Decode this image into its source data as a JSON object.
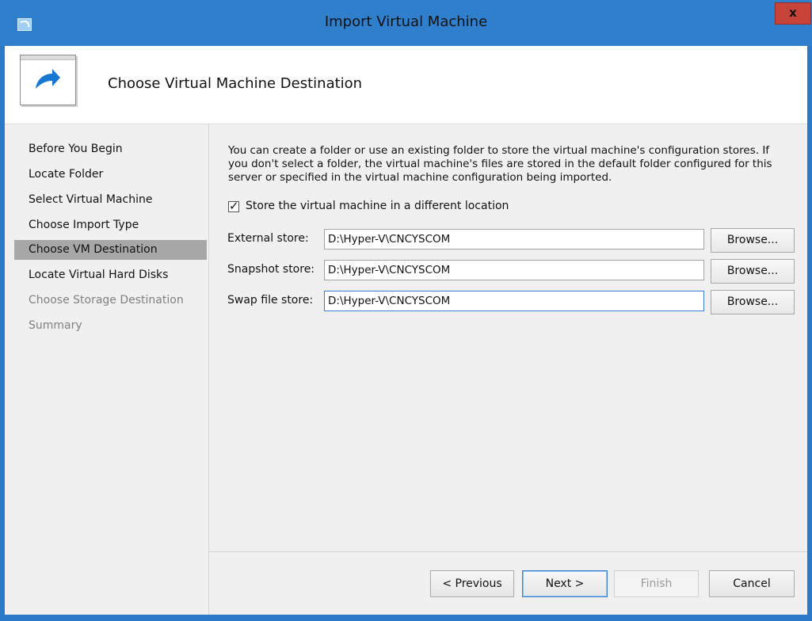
{
  "window": {
    "title": "Import Virtual Machine",
    "close_label": "x",
    "colors": {
      "frame": "#2f7fcd",
      "close": "#c94438",
      "selected_nav": "#a7a7a7"
    }
  },
  "header": {
    "title": "Choose Virtual Machine Destination",
    "icon": "arrow-right-icon"
  },
  "nav": {
    "items": [
      {
        "label": "Before You Begin",
        "state": "normal"
      },
      {
        "label": "Locate Folder",
        "state": "normal"
      },
      {
        "label": "Select Virtual Machine",
        "state": "normal"
      },
      {
        "label": "Choose Import Type",
        "state": "normal"
      },
      {
        "label": "Choose VM Destination",
        "state": "selected"
      },
      {
        "label": "Locate Virtual Hard Disks",
        "state": "normal"
      },
      {
        "label": "Choose Storage Destination",
        "state": "disabled"
      },
      {
        "label": "Summary",
        "state": "disabled"
      }
    ]
  },
  "content": {
    "description": "You can create a folder or use an existing folder to store the virtual machine's configuration stores. If you don't select a folder, the virtual machine's files are stored in the default folder configured for this server or specified in the virtual machine configuration being imported.",
    "different_location_label": "Store the virtual machine in a different location",
    "different_location_checked": true,
    "fields": [
      {
        "label": "External store:",
        "value": "D:\\Hyper-V\\CNCYSCOM",
        "browse_label": "Browse..."
      },
      {
        "label": "Snapshot store:",
        "value": "D:\\Hyper-V\\CNCYSCOM",
        "browse_label": "Browse..."
      },
      {
        "label": "Swap file store:",
        "value": "D:\\Hyper-V\\CNCYSCOM",
        "browse_label": "Browse..."
      }
    ]
  },
  "footer": {
    "previous_label": "< Previous",
    "next_label": "Next >",
    "finish_label": "Finish",
    "cancel_label": "Cancel"
  }
}
